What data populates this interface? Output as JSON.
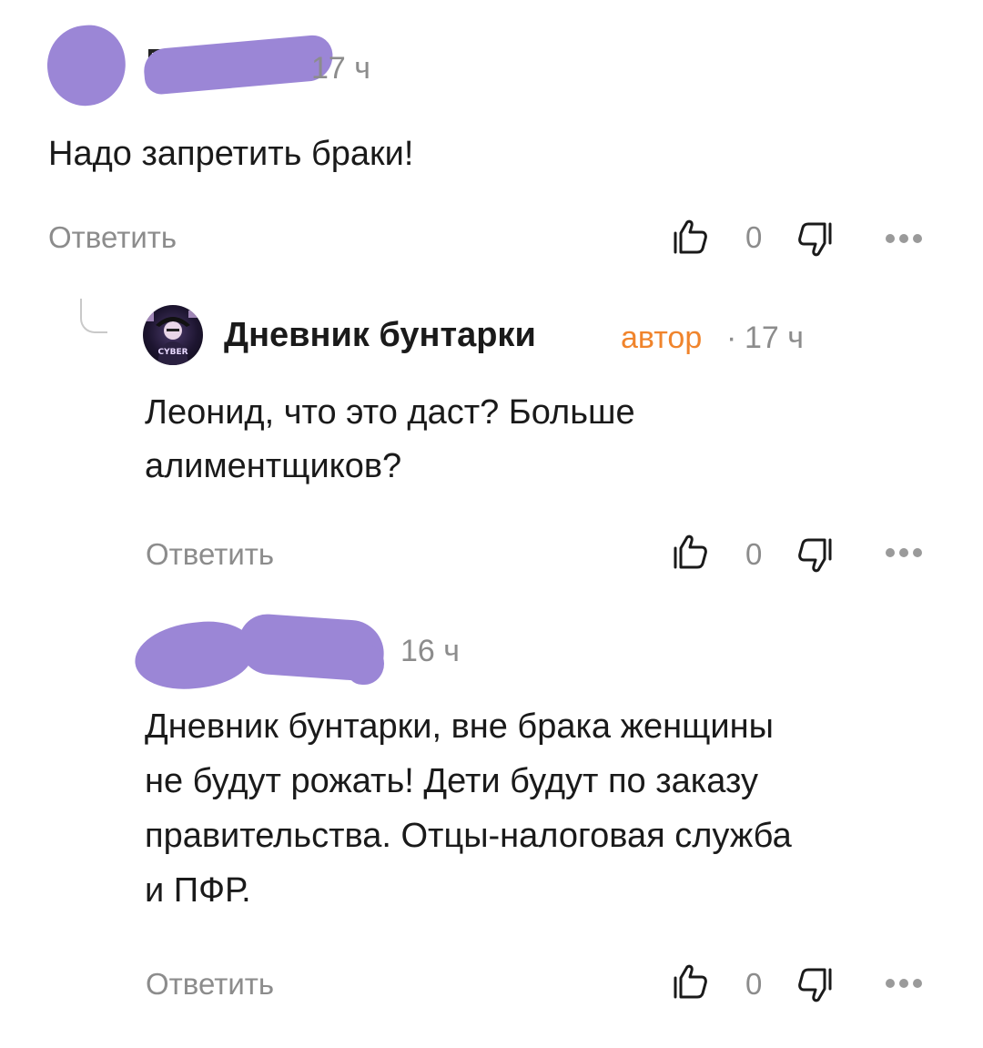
{
  "comments": [
    {
      "time": "17 ч",
      "name_fragment": "",
      "text": "Надо запретить браки!",
      "reply_label": "Ответить",
      "likes": "0"
    },
    {
      "author_name": "Дневник бунтарки",
      "author_badge": "автор",
      "separator": "·",
      "time": "17 ч",
      "avatar_caption": "CYBER",
      "text_lines": [
        "Леонид, что это даст? Больше",
        "алиментщиков?"
      ],
      "reply_label": "Ответить",
      "likes": "0"
    },
    {
      "time": "16 ч",
      "text_lines": [
        "Дневник бунтарки, вне брака женщины",
        "не будут рожать! Дети будут по заказу",
        "правительства. Отцы-налоговая служба",
        "и ПФР."
      ],
      "reply_label": "Ответить",
      "likes": "0"
    }
  ],
  "colors": {
    "redaction": "#9b86d6",
    "author_badge": "#f0842c",
    "muted_text": "#8c8c8c",
    "text": "#1a1a1a"
  },
  "icons": [
    "thumb-up-icon",
    "thumb-down-icon",
    "more-dots-icon"
  ]
}
